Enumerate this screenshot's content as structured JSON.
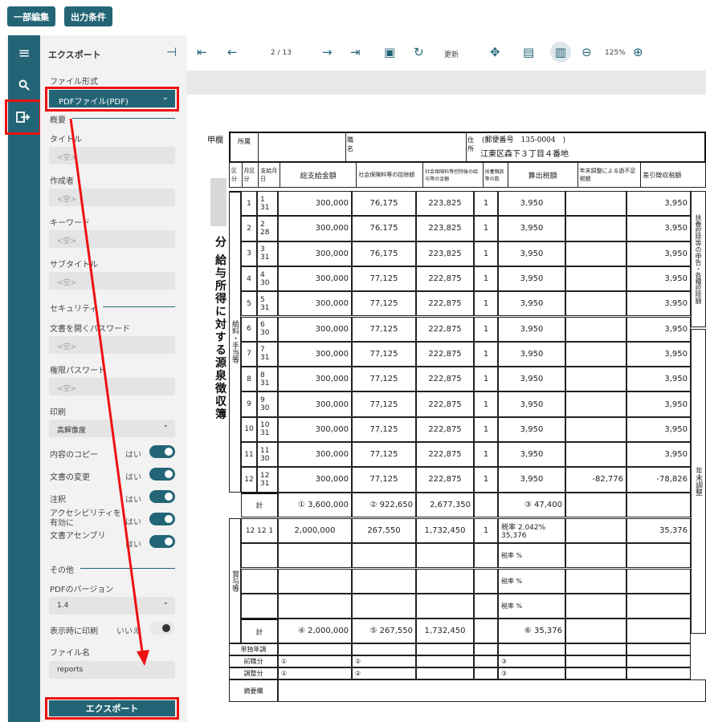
{
  "top_buttons": {
    "partial_edit": "一部編集",
    "output_conditions": "出力条件"
  },
  "panel": {
    "title": "エクスポート",
    "file_format_label": "ファイル形式",
    "file_format_value": "PDFファイル(PDF)",
    "summary_section": "概要",
    "title_label": "タイトル",
    "author_label": "作成者",
    "keyword_label": "キーワード",
    "subtitle_label": "サブタイトル",
    "empty_placeholder": "<空>",
    "security_section": "セキュリティ",
    "open_password_label": "文書を開くパスワード",
    "permission_password_label": "権限パスワード",
    "print_label": "印刷",
    "print_value": "高解像度",
    "copy_label": "内容のコピー",
    "change_label": "文書の変更",
    "annotation_label": "注釈",
    "accessibility_label": "アクセシビリティを有効に",
    "assembly_label": "文書アセンブリ",
    "yes": "はい",
    "no": "いいえ",
    "other_section": "その他",
    "pdf_version_label": "PDFのバージョン",
    "pdf_version_value": "1.4",
    "print_on_display_label": "表示時に印刷",
    "filename_label": "ファイル名",
    "filename_value": "reports",
    "export_button": "エクスポート"
  },
  "toolbar": {
    "page": "2 / 13",
    "refresh": "更新",
    "zoom": "125%"
  },
  "document": {
    "heading_left": "甲欄",
    "vertical_title": "分 給与所得に対する源泉徴収簿",
    "dept_label": "所属",
    "position_label": "職名",
    "address_label": "住所",
    "postal": "(郵便番号　135-0004　)",
    "address": "江東区森下３丁目４番地",
    "headers": [
      "区分",
      "月区分",
      "支給月日",
      "総支給金額",
      "社会保険料等の控除額",
      "社会保険料等控除後の給与等の金額",
      "扶養親族等の数",
      "算出税額",
      "年末調整による過不足税額",
      "差引徴収税額"
    ],
    "side_note": "扶養控除等の申告・各種控除額",
    "salary_label": "給料・手当等",
    "rows": [
      {
        "m": "1",
        "d": "1",
        "day": "31",
        "gross": "300,000",
        "ins": "76,175",
        "after": "223,825",
        "dep": "1",
        "tax": "3,950",
        "adj": "",
        "net": "3,950"
      },
      {
        "m": "2",
        "d": "2",
        "day": "28",
        "gross": "300,000",
        "ins": "76,175",
        "after": "223,825",
        "dep": "1",
        "tax": "3,950",
        "adj": "",
        "net": "3,950"
      },
      {
        "m": "3",
        "d": "3",
        "day": "31",
        "gross": "300,000",
        "ins": "76,175",
        "after": "223,825",
        "dep": "1",
        "tax": "3,950",
        "adj": "",
        "net": "3,950"
      },
      {
        "m": "4",
        "d": "4",
        "day": "30",
        "gross": "300,000",
        "ins": "77,125",
        "after": "222,875",
        "dep": "1",
        "tax": "3,950",
        "adj": "",
        "net": "3,950"
      },
      {
        "m": "5",
        "d": "5",
        "day": "31",
        "gross": "300,000",
        "ins": "77,125",
        "after": "222,875",
        "dep": "1",
        "tax": "3,950",
        "adj": "",
        "net": "3,950"
      },
      {
        "m": "6",
        "d": "6",
        "day": "30",
        "gross": "300,000",
        "ins": "77,125",
        "after": "222,875",
        "dep": "1",
        "tax": "3,950",
        "adj": "",
        "net": "3,950"
      },
      {
        "m": "7",
        "d": "7",
        "day": "31",
        "gross": "300,000",
        "ins": "77,125",
        "after": "222,875",
        "dep": "1",
        "tax": "3,950",
        "adj": "",
        "net": "3,950"
      },
      {
        "m": "8",
        "d": "8",
        "day": "31",
        "gross": "300,000",
        "ins": "77,125",
        "after": "222,875",
        "dep": "1",
        "tax": "3,950",
        "adj": "",
        "net": "3,950"
      },
      {
        "m": "9",
        "d": "9",
        "day": "30",
        "gross": "300,000",
        "ins": "77,125",
        "after": "222,875",
        "dep": "1",
        "tax": "3,950",
        "adj": "",
        "net": "3,950"
      },
      {
        "m": "10",
        "d": "10",
        "day": "31",
        "gross": "300,000",
        "ins": "77,125",
        "after": "222,875",
        "dep": "1",
        "tax": "3,950",
        "adj": "",
        "net": "3,950"
      },
      {
        "m": "11",
        "d": "11",
        "day": "30",
        "gross": "300,000",
        "ins": "77,125",
        "after": "222,875",
        "dep": "1",
        "tax": "3,950",
        "adj": "",
        "net": "3,950"
      },
      {
        "m": "12",
        "d": "12",
        "day": "31",
        "gross": "300,000",
        "ins": "77,125",
        "after": "222,875",
        "dep": "1",
        "tax": "3,950",
        "adj": "-82,776",
        "net": "-78,826"
      }
    ],
    "total_label": "計",
    "total": {
      "gross": "3,600,000",
      "ins": "922,650",
      "after": "2,677,350",
      "tax": "47,400"
    },
    "bonus_label": "賞与等",
    "bonus_row": {
      "m": "12",
      "d": "12",
      "day": "1",
      "gross": "2,000,000",
      "ins": "267,550",
      "after": "1,732,450",
      "dep": "1",
      "rate": "2.042",
      "tax": "35,376",
      "net": "35,376"
    },
    "rate_label": "税率",
    "bonus_total": {
      "gross": "2,000,000",
      "ins": "267,550",
      "after": "1,732,450",
      "tax": "35,376"
    },
    "year_end_label": "年末調整",
    "solo_label": "単独年調",
    "prev_job_label": "前職分",
    "adjusted_label": "調整分",
    "notes_label": "摘要欄",
    "circle_nums": [
      "①",
      "②",
      "③",
      "④",
      "⑤",
      "⑥"
    ],
    "yen": "円",
    "pct": "%"
  },
  "colors": {
    "accent": "#236576",
    "highlight": "#e11111"
  }
}
